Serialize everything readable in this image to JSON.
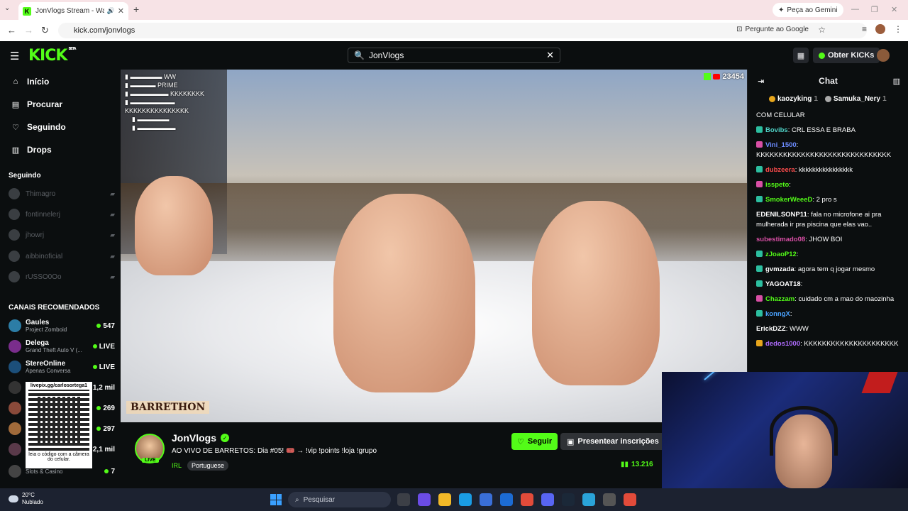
{
  "browser": {
    "tab_title": "JonVlogs Stream - Watch L",
    "favicon_letter": "K",
    "url": "kick.com/jonvlogs",
    "gemini_label": "Peça ao Gemini",
    "google_label": "Pergunte ao Google"
  },
  "kick": {
    "logo": "KICK",
    "logo_beta": "BETA",
    "search_value": "JonVlogs",
    "kicks_label": "Obter KICKs"
  },
  "sidebar": {
    "nav": [
      {
        "label": "Início",
        "icon": "home-icon"
      },
      {
        "label": "Procurar",
        "icon": "browse-icon"
      },
      {
        "label": "Seguindo",
        "icon": "heart-icon"
      },
      {
        "label": "Drops",
        "icon": "drops-icon"
      }
    ],
    "following_title": "Seguindo",
    "following": [
      "Thimagro",
      "fontinnelerj",
      "jhowrj",
      "aibbinoficial",
      "rUSSO0Oo"
    ],
    "recommended_title": "CANAIS RECOMENDADOS",
    "recommended": [
      {
        "name": "Gaules",
        "category": "Project Zomboid",
        "viewers": "547"
      },
      {
        "name": "Delega",
        "category": "Grand Theft Auto V (...",
        "viewers": "LIVE"
      },
      {
        "name": "StereOnline",
        "category": "Apenas Conversa",
        "viewers": "LIVE"
      },
      {
        "name": "",
        "category": "",
        "viewers": "1,2 mil"
      },
      {
        "name": "",
        "category": "",
        "viewers": "269"
      },
      {
        "name": "",
        "category": "",
        "viewers": "297"
      },
      {
        "name": "",
        "category": "",
        "viewers": "2,1 mil"
      },
      {
        "name": "",
        "category": "Slots & Casino",
        "viewers": "7"
      }
    ],
    "qr_link": "livepix.gg/carlosortega1",
    "qr_caption": "leia o código com a câmera do celular."
  },
  "player": {
    "viewer_count": "23454",
    "overlay_lines": [
      "KKKKKKKKKKKKKKK"
    ],
    "brand": "BARRETHON"
  },
  "channel": {
    "name": "JonVlogs",
    "live_tag": "LIVE",
    "title": "AO VIVO DE BARRETOS: Dia #05! 🎟️ → !vip !points !loja !grupo",
    "category": "IRL",
    "language": "Portuguese",
    "follow_label": "Seguir",
    "gift_label": "Presentear inscrições",
    "viewers": "13.216"
  },
  "chat": {
    "title": "Chat",
    "pinned": [
      "kaozyking",
      "Samuka_Nery"
    ],
    "pinned_counts": [
      "1",
      "1"
    ],
    "messages": [
      {
        "user": "",
        "text": "COM CELULAR",
        "color": "#ffffff",
        "badge": ""
      },
      {
        "user": "Bovibs",
        "text": ": CRL ESSA E BRABA",
        "color": "#4fd1c5",
        "badge": "teal"
      },
      {
        "user": "Vini_1500",
        "text": ": KKKKKKKKKKKKKKKKKKKKKKKKKKKKKK",
        "color": "#6c8cff",
        "badge": "pink"
      },
      {
        "user": "dubzeera",
        "text": ": kkkkkkkkkkkkkkkk",
        "color": "#ff4d4d",
        "badge": "teal"
      },
      {
        "user": "isspeto",
        "text": ":",
        "color": "#53fc18",
        "badge": "pink"
      },
      {
        "user": "SmokerWeeeD",
        "text": ": 2 pro s",
        "color": "#53fc18",
        "badge": "teal"
      },
      {
        "user": "EDENILSONP11",
        "text": ": fala no microfone ai pra mulherada ir pra piscina que elas vao..",
        "color": "#ffffff",
        "badge": ""
      },
      {
        "user": "subestimado08",
        "text": ": JHOW BOI",
        "color": "#d84fa5",
        "badge": ""
      },
      {
        "user": "zJoaoP12",
        "text": ":",
        "color": "#53fc18",
        "badge": "teal"
      },
      {
        "user": "gvmzada",
        "text": ": agora tem q jogar mesmo",
        "color": "#ffffff",
        "badge": "teal"
      },
      {
        "user": "YAGOAT18",
        "text": ":",
        "color": "#ffffff",
        "badge": "teal"
      },
      {
        "user": "Chazzam",
        "text": ": cuidado cm a mao do maozinha",
        "color": "#53fc18",
        "badge": "pink"
      },
      {
        "user": "konngX",
        "text": ":",
        "color": "#4aa3ff",
        "badge": "teal"
      },
      {
        "user": "ErickDZZ",
        "text": ": WWW",
        "color": "#ffffff",
        "badge": ""
      },
      {
        "user": "dedos1000",
        "text": ": KKKKKKKKKKKKKKKKKKKKK",
        "color": "#b06cff",
        "badge": "gold"
      }
    ]
  },
  "taskbar": {
    "temp": "20°C",
    "weather": "Nublado",
    "search_placeholder": "Pesquisar"
  }
}
